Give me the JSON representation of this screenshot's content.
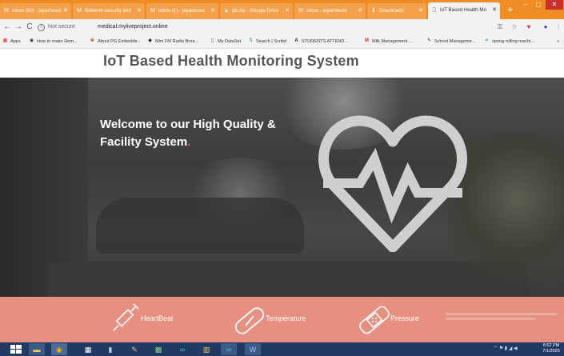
{
  "browser": {
    "tabs": [
      {
        "label": "Inbox (80) - jayamcoul",
        "icon": "gmail-icon",
        "active": false
      },
      {
        "label": "Network security and",
        "icon": "gmail-icon",
        "active": false
      },
      {
        "label": "Inbox (1) - jayamcoul",
        "icon": "gmail-icon",
        "active": false
      },
      {
        "label": "qb.zip - Google Drive",
        "icon": "drive-icon",
        "active": false
      },
      {
        "label": "Inbox - jayamtechi",
        "icon": "gmail-icon",
        "active": false
      },
      {
        "label": "Downloads",
        "icon": "download-icon",
        "active": false
      },
      {
        "label": "IoT Based Health Mo",
        "icon": "page-icon",
        "active": true
      }
    ],
    "security_label": "Not secure",
    "url": "medical.myliveproject.online",
    "bookmarks": [
      {
        "label": "Apps",
        "icon": "apps-icon"
      },
      {
        "label": "How to make Hom...",
        "icon": "globe-icon"
      },
      {
        "label": "About PG Embedde...",
        "icon": "flower-icon"
      },
      {
        "label": "Mini FM Radio Broa...",
        "icon": "bird-icon"
      },
      {
        "label": "My DataSet",
        "icon": "doc-icon"
      },
      {
        "label": "Search | Scribd",
        "icon": "scribd-icon"
      },
      {
        "label": "STUDENTS ATTEND...",
        "icon": "a-icon"
      },
      {
        "label": "Milk Management ...",
        "icon": "gmail-icon"
      },
      {
        "label": "School Manageme...",
        "icon": "pen-icon"
      },
      {
        "label": "spring rolling machi...",
        "icon": "twitter-icon"
      }
    ],
    "more_bookmarks": "»"
  },
  "page": {
    "title": "IoT Based Health Monitoring System",
    "hero_line1": "Welcome to our High Quality &",
    "hero_line2": "Facility System",
    "hero_dot": ".",
    "features": [
      {
        "label": "HeartBeat",
        "icon": "syringe-icon"
      },
      {
        "label": "Temperature",
        "icon": "capsule-icon"
      },
      {
        "label": "Pressure",
        "icon": "bandage-icon"
      }
    ]
  },
  "taskbar": {
    "clock_time": "8:52 PM",
    "clock_date": "7/1/2020"
  },
  "colors": {
    "tabstrip": "#f08c24",
    "feature_band": "#e79081",
    "accent_dot": "#e74c3c",
    "taskbar": "#213a64"
  }
}
